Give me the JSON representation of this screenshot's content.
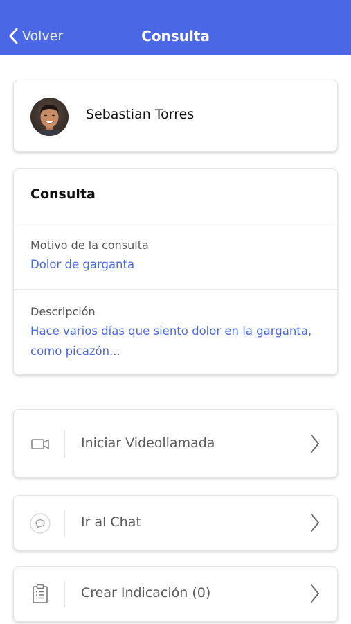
{
  "header": {
    "back_label": "Volver",
    "title": "Consulta",
    "background": "#4a67e6"
  },
  "user": {
    "name": "Sebastian Torres",
    "avatar_icon": "avatar-photo"
  },
  "consulta": {
    "title": "Consulta",
    "motivo_label": "Motivo de la consulta",
    "motivo_value": "Dolor de garganta",
    "descripcion_label": "Descripción",
    "descripcion_value": "Hace varios días que siento dolor en la garganta, como picazón..."
  },
  "actions": [
    {
      "label": "Iniciar Videollamada",
      "icon": "video-camera-icon"
    },
    {
      "label": "Ir al Chat",
      "icon": "chat-bubble-icon"
    },
    {
      "label": "Crear Indicación (0)",
      "icon": "clipboard-icon"
    }
  ],
  "colors": {
    "accent": "#4a67e6",
    "text_dark": "#111111",
    "text_muted": "#555555"
  }
}
